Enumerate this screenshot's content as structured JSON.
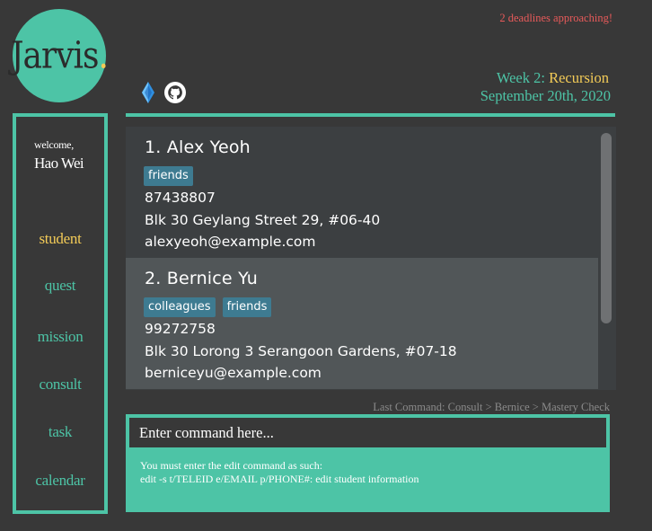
{
  "app": {
    "logo_text": "Jarvis",
    "logo_dot": "."
  },
  "header": {
    "deadline_notice": "2 deadlines approaching!",
    "week_prefix": "Week 2: ",
    "week_topic": "Recursion",
    "date": "September 20th, 2020"
  },
  "sidebar": {
    "welcome": "welcome,",
    "username": "Hao Wei",
    "items": [
      {
        "label": "student",
        "active": true
      },
      {
        "label": "quest",
        "active": false
      },
      {
        "label": "mission",
        "active": false
      },
      {
        "label": "consult",
        "active": false
      },
      {
        "label": "task",
        "active": false
      },
      {
        "label": "calendar",
        "active": false
      }
    ]
  },
  "toolbar": {
    "icons": [
      "diamond-icon",
      "github-icon"
    ]
  },
  "students": [
    {
      "index_name": "1.  Alex Yeoh",
      "tags": [
        "friends"
      ],
      "phone": "87438807",
      "address": "Blk 30 Geylang Street 29, #06-40",
      "email": "alexyeoh@example.com"
    },
    {
      "index_name": "2.  Bernice Yu",
      "tags": [
        "colleagues",
        "friends"
      ],
      "phone": "99272758",
      "address": "Blk 30 Lorong 3 Serangoon Gardens, #07-18",
      "email": "berniceyu@example.com"
    }
  ],
  "last_command": "Last Command: Consult > Bernice > Mastery Check",
  "command": {
    "placeholder": "Enter command here...",
    "value": "",
    "result_line1": "You must enter the edit command as such:",
    "result_line2": "edit -s t/TELEID e/EMAIL p/PHONE#: edit student information"
  },
  "colors": {
    "accent": "#4DC4A6",
    "highlight": "#F3CB57",
    "warning": "#E85A5A",
    "background": "#383838",
    "tag": "#3e7b91"
  }
}
